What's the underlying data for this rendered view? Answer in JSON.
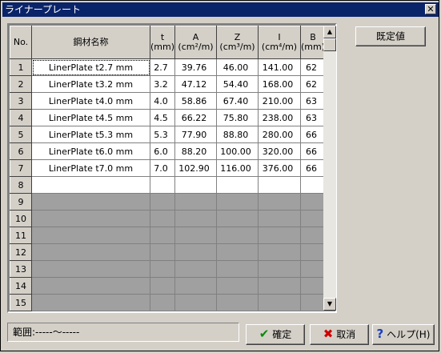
{
  "window": {
    "title": "ライナープレート",
    "close_glyph": "✕"
  },
  "grid": {
    "columns": [
      {
        "label": "No."
      },
      {
        "label": "鋼材名称"
      },
      {
        "label": "t",
        "unit": "(mm)"
      },
      {
        "label": "A",
        "unit": "(cm²/m)"
      },
      {
        "label": "Z",
        "unit": "(cm³/m)"
      },
      {
        "label": "I",
        "unit": "(cm⁴/m)"
      },
      {
        "label": "B",
        "unit": "(mm)"
      }
    ],
    "rows": [
      {
        "no": "1",
        "name": "LinerPlate t2.7 mm",
        "t": "2.7",
        "a": "39.76",
        "z": "46.00",
        "i": "141.00",
        "b": "62"
      },
      {
        "no": "2",
        "name": "LinerPlate t3.2 mm",
        "t": "3.2",
        "a": "47.12",
        "z": "54.40",
        "i": "168.00",
        "b": "62"
      },
      {
        "no": "3",
        "name": "LinerPlate t4.0 mm",
        "t": "4.0",
        "a": "58.86",
        "z": "67.40",
        "i": "210.00",
        "b": "63"
      },
      {
        "no": "4",
        "name": "LinerPlate t4.5 mm",
        "t": "4.5",
        "a": "66.22",
        "z": "75.80",
        "i": "238.00",
        "b": "63"
      },
      {
        "no": "5",
        "name": "LinerPlate t5.3 mm",
        "t": "5.3",
        "a": "77.90",
        "z": "88.80",
        "i": "280.00",
        "b": "66"
      },
      {
        "no": "6",
        "name": "LinerPlate t6.0 mm",
        "t": "6.0",
        "a": "88.20",
        "z": "100.00",
        "i": "320.00",
        "b": "66"
      },
      {
        "no": "7",
        "name": "LinerPlate t7.0 mm",
        "t": "7.0",
        "a": "102.90",
        "z": "116.00",
        "i": "376.00",
        "b": "66"
      }
    ],
    "blank_row_numbers": [
      "8"
    ],
    "empty_row_numbers": [
      "9",
      "10",
      "11",
      "12",
      "13",
      "14",
      "15"
    ]
  },
  "buttons": {
    "default_values": "既定値",
    "ok": "確定",
    "cancel": "取消",
    "help": "ヘルプ(H)"
  },
  "status": {
    "range_text": "範囲:-----〜-----"
  },
  "colors": {
    "titlebar": "#0a246a",
    "face": "#d4d0c8",
    "empty_cell": "#a0a0a0"
  }
}
